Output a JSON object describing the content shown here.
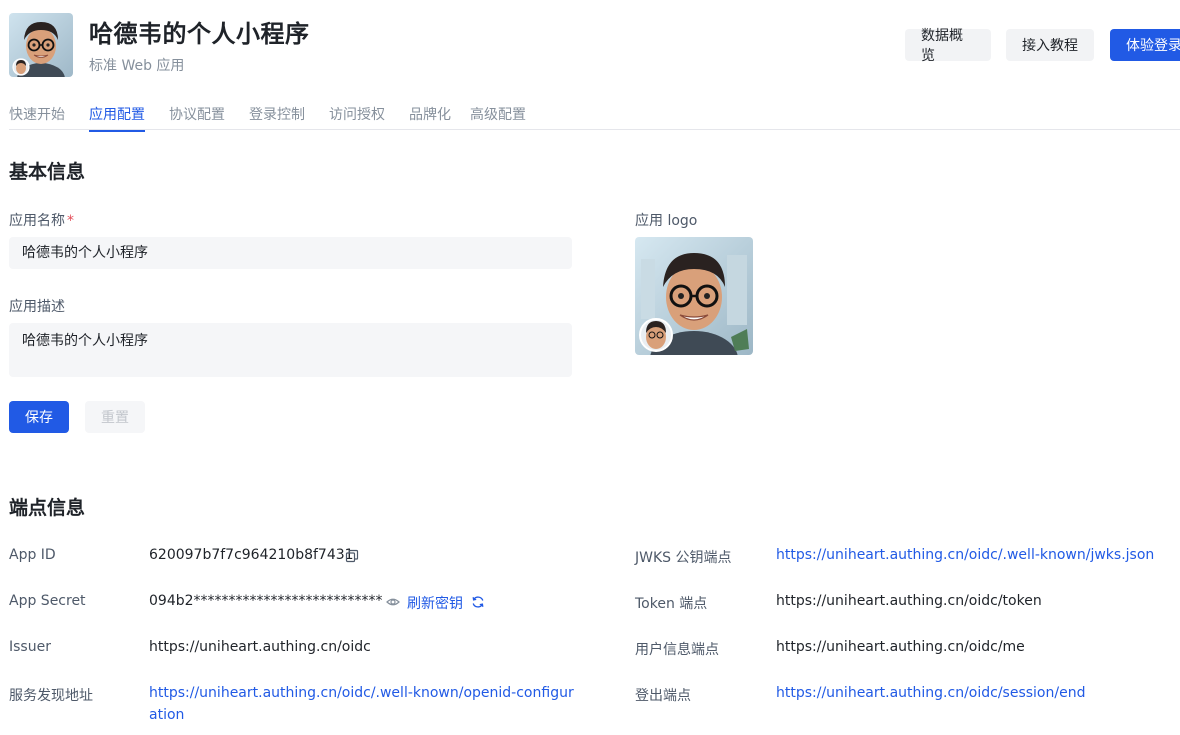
{
  "header": {
    "title": "哈德韦的个人小程序",
    "subtitle": "标准 Web 应用",
    "buttons": {
      "data_overview": "数据概览",
      "tutorial": "接入教程",
      "try_login": "体验登录"
    }
  },
  "tabs": [
    {
      "label": "快速开始",
      "active": false
    },
    {
      "label": "应用配置",
      "active": true
    },
    {
      "label": "协议配置",
      "active": false
    },
    {
      "label": "登录控制",
      "active": false
    },
    {
      "label": "访问授权",
      "active": false
    },
    {
      "label": "品牌化",
      "active": false
    },
    {
      "label": "高级配置",
      "active": false
    }
  ],
  "basic_info": {
    "title": "基本信息",
    "name_label": "应用名称",
    "name_required": "*",
    "name_value": "哈德韦的个人小程序",
    "desc_label": "应用描述",
    "desc_value": "哈德韦的个人小程序",
    "logo_label": "应用 logo",
    "save_label": "保存",
    "reset_label": "重置"
  },
  "endpoints": {
    "title": "端点信息",
    "left": [
      {
        "label": "App ID",
        "value": "620097b7f7c964210b8f7431",
        "copy_icon": "copy-icon"
      },
      {
        "label": "App Secret",
        "value": "094b2***************************",
        "reveal_icon": "eye-icon",
        "refresh_label": "刷新密钥",
        "refresh_icon": "refresh-icon"
      },
      {
        "label": "Issuer",
        "value": "https://uniheart.authing.cn/oidc"
      },
      {
        "label": "服务发现地址",
        "value": "https://uniheart.authing.cn/oidc/.well-known/openid-configuration"
      }
    ],
    "right": [
      {
        "label": "JWKS 公钥端点",
        "value": "https://uniheart.authing.cn/oidc/.well-known/jwks.json"
      },
      {
        "label": "Token 端点",
        "value": "https://uniheart.authing.cn/oidc/token"
      },
      {
        "label": "用户信息端点",
        "value": "https://uniheart.authing.cn/oidc/me"
      },
      {
        "label": "登出端点",
        "value": "https://uniheart.authing.cn/oidc/session/end"
      }
    ]
  },
  "colors": {
    "primary": "#215ae5",
    "required": "#e34d59"
  }
}
